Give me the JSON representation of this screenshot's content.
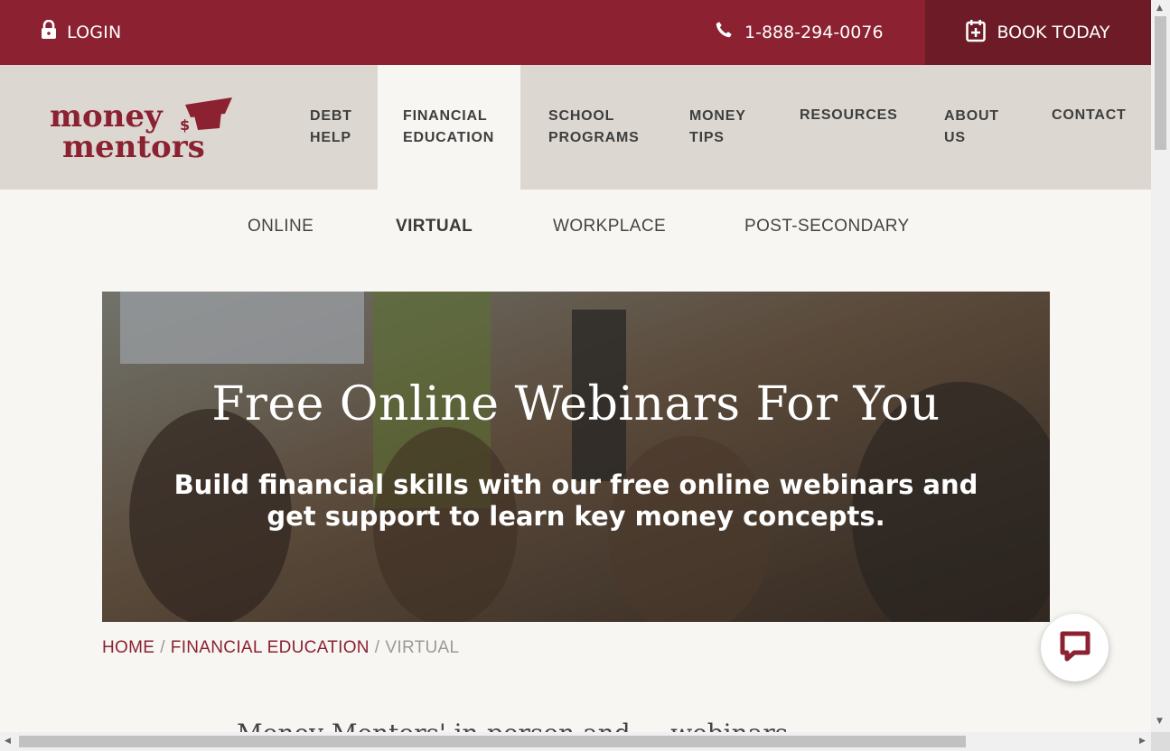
{
  "topbar": {
    "login": "LOGIN",
    "phone": "1-888-294-0076",
    "book": "BOOK TODAY",
    "icons": {
      "login": "lock-icon",
      "phone": "phone-icon",
      "book": "calendar-plus-icon"
    },
    "colors": {
      "bar": "#8b2131",
      "book_bg": "#6c1b27"
    }
  },
  "logo": {
    "line1": "money",
    "line2": "mentors",
    "icon": "graduation-cap-dollar-icon"
  },
  "nav": {
    "debt_help": [
      "DEBT",
      "HELP"
    ],
    "financial_education": [
      "FINANCIAL",
      "EDUCATION"
    ],
    "school_programs": [
      "SCHOOL",
      "PROGRAMS"
    ],
    "money_tips": [
      "MONEY",
      "TIPS"
    ],
    "resources": "RESOURCES",
    "about_us": [
      "ABOUT",
      "US"
    ],
    "contact": "CONTACT"
  },
  "subnav": {
    "online": "ONLINE",
    "virtual": "VIRTUAL",
    "workplace": "WORKPLACE",
    "post_secondary": "POST-SECONDARY"
  },
  "hero": {
    "title": "Free Online Webinars For You",
    "subtitle": "Build financial skills with our free online webinars and get support to learn key money concepts."
  },
  "breadcrumb": {
    "home": "HOME",
    "sep": "/",
    "financial_education": "FINANCIAL EDUCATION",
    "current": "VIRTUAL"
  },
  "partial_text": "Money Mentors' in-person and ... webinars",
  "chat": {
    "icon": "chat-bubble-icon"
  }
}
